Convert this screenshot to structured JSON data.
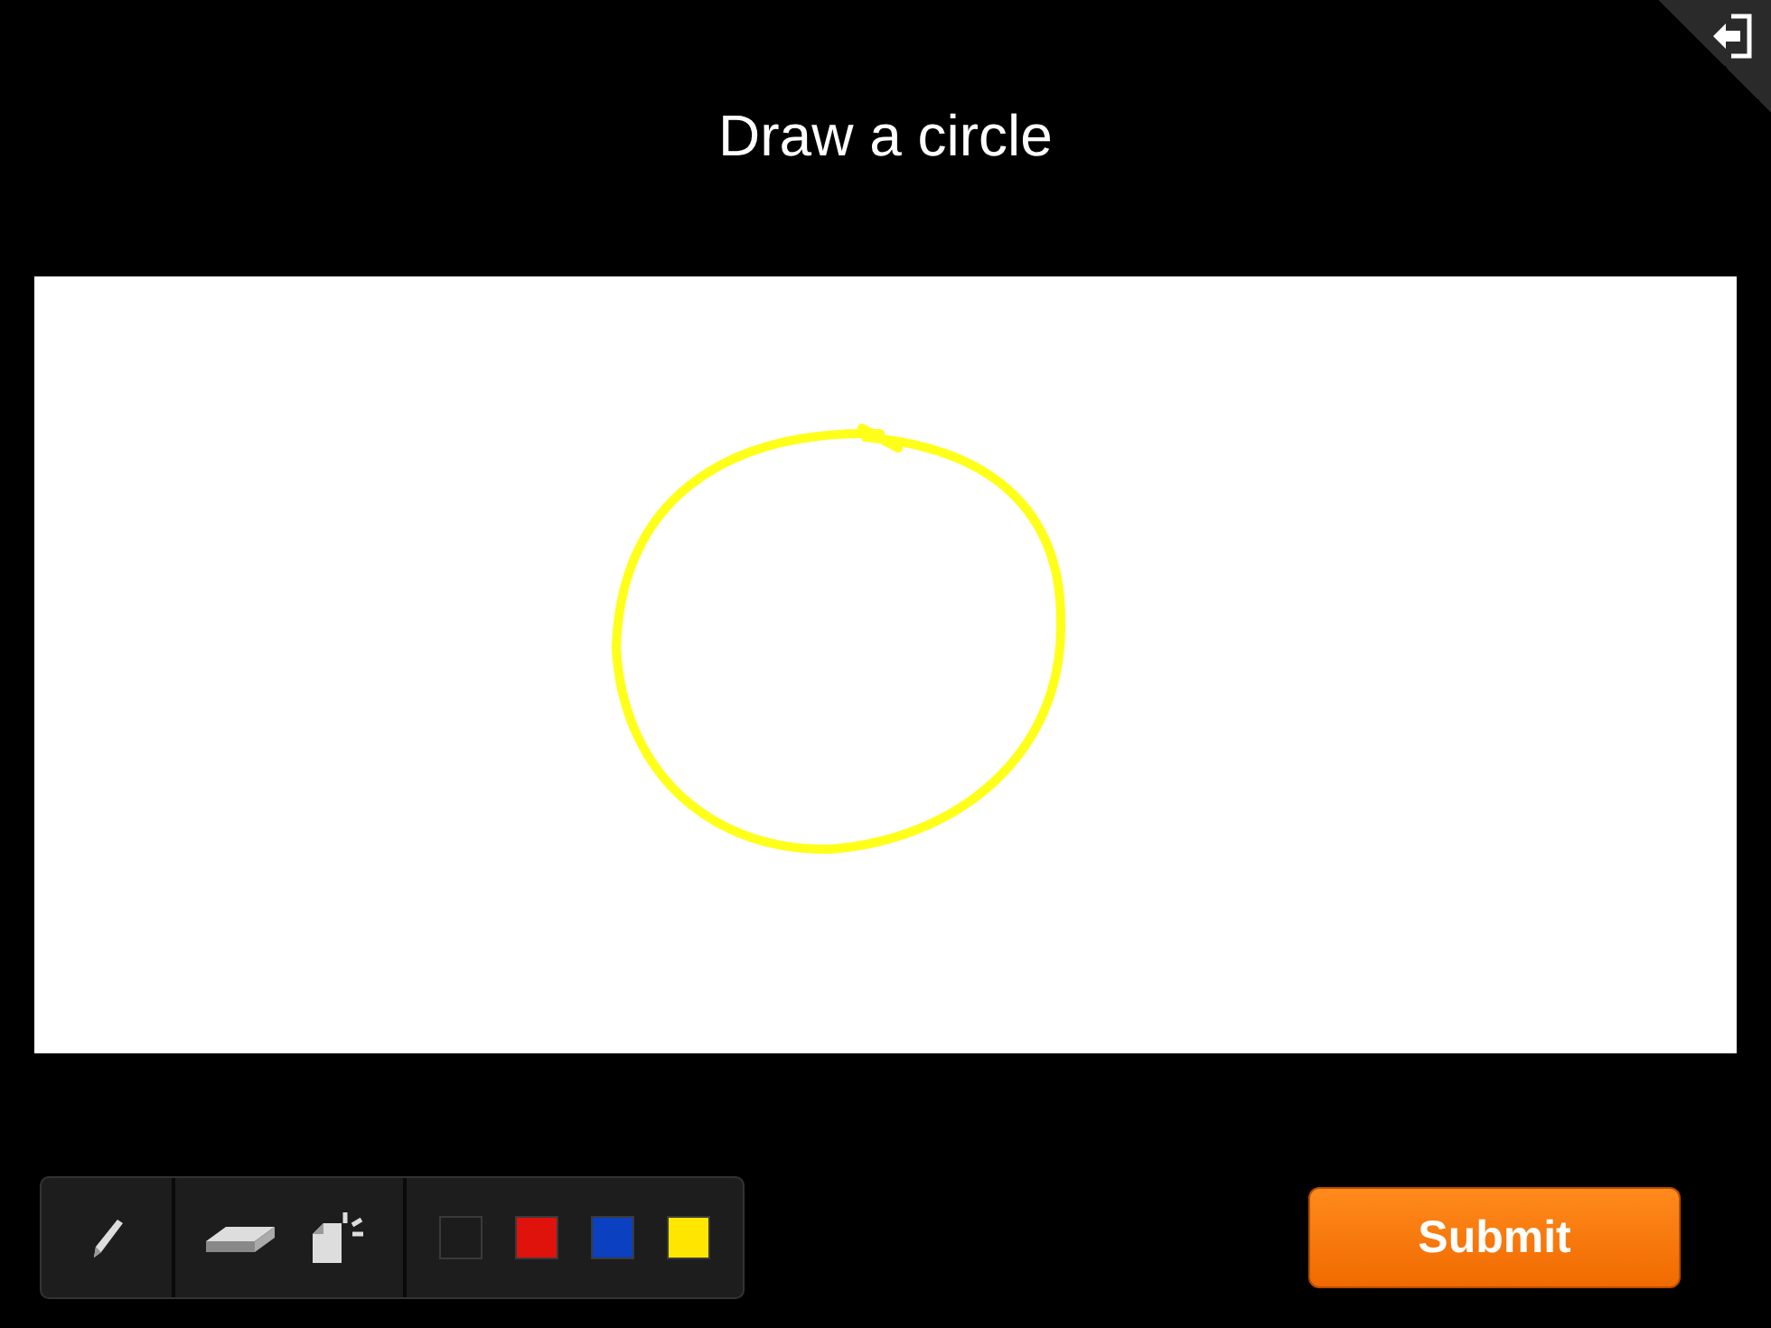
{
  "title": "Draw a circle",
  "tools": [
    {
      "kind": "pencil"
    },
    {
      "kind": "eraser"
    },
    {
      "kind": "clear"
    }
  ],
  "colors": [
    {
      "color": "#1c1c1c"
    },
    {
      "color": "#e0120c"
    },
    {
      "color": "#0b40c0"
    },
    {
      "color": "#ffe600"
    }
  ],
  "submit": "Submit"
}
